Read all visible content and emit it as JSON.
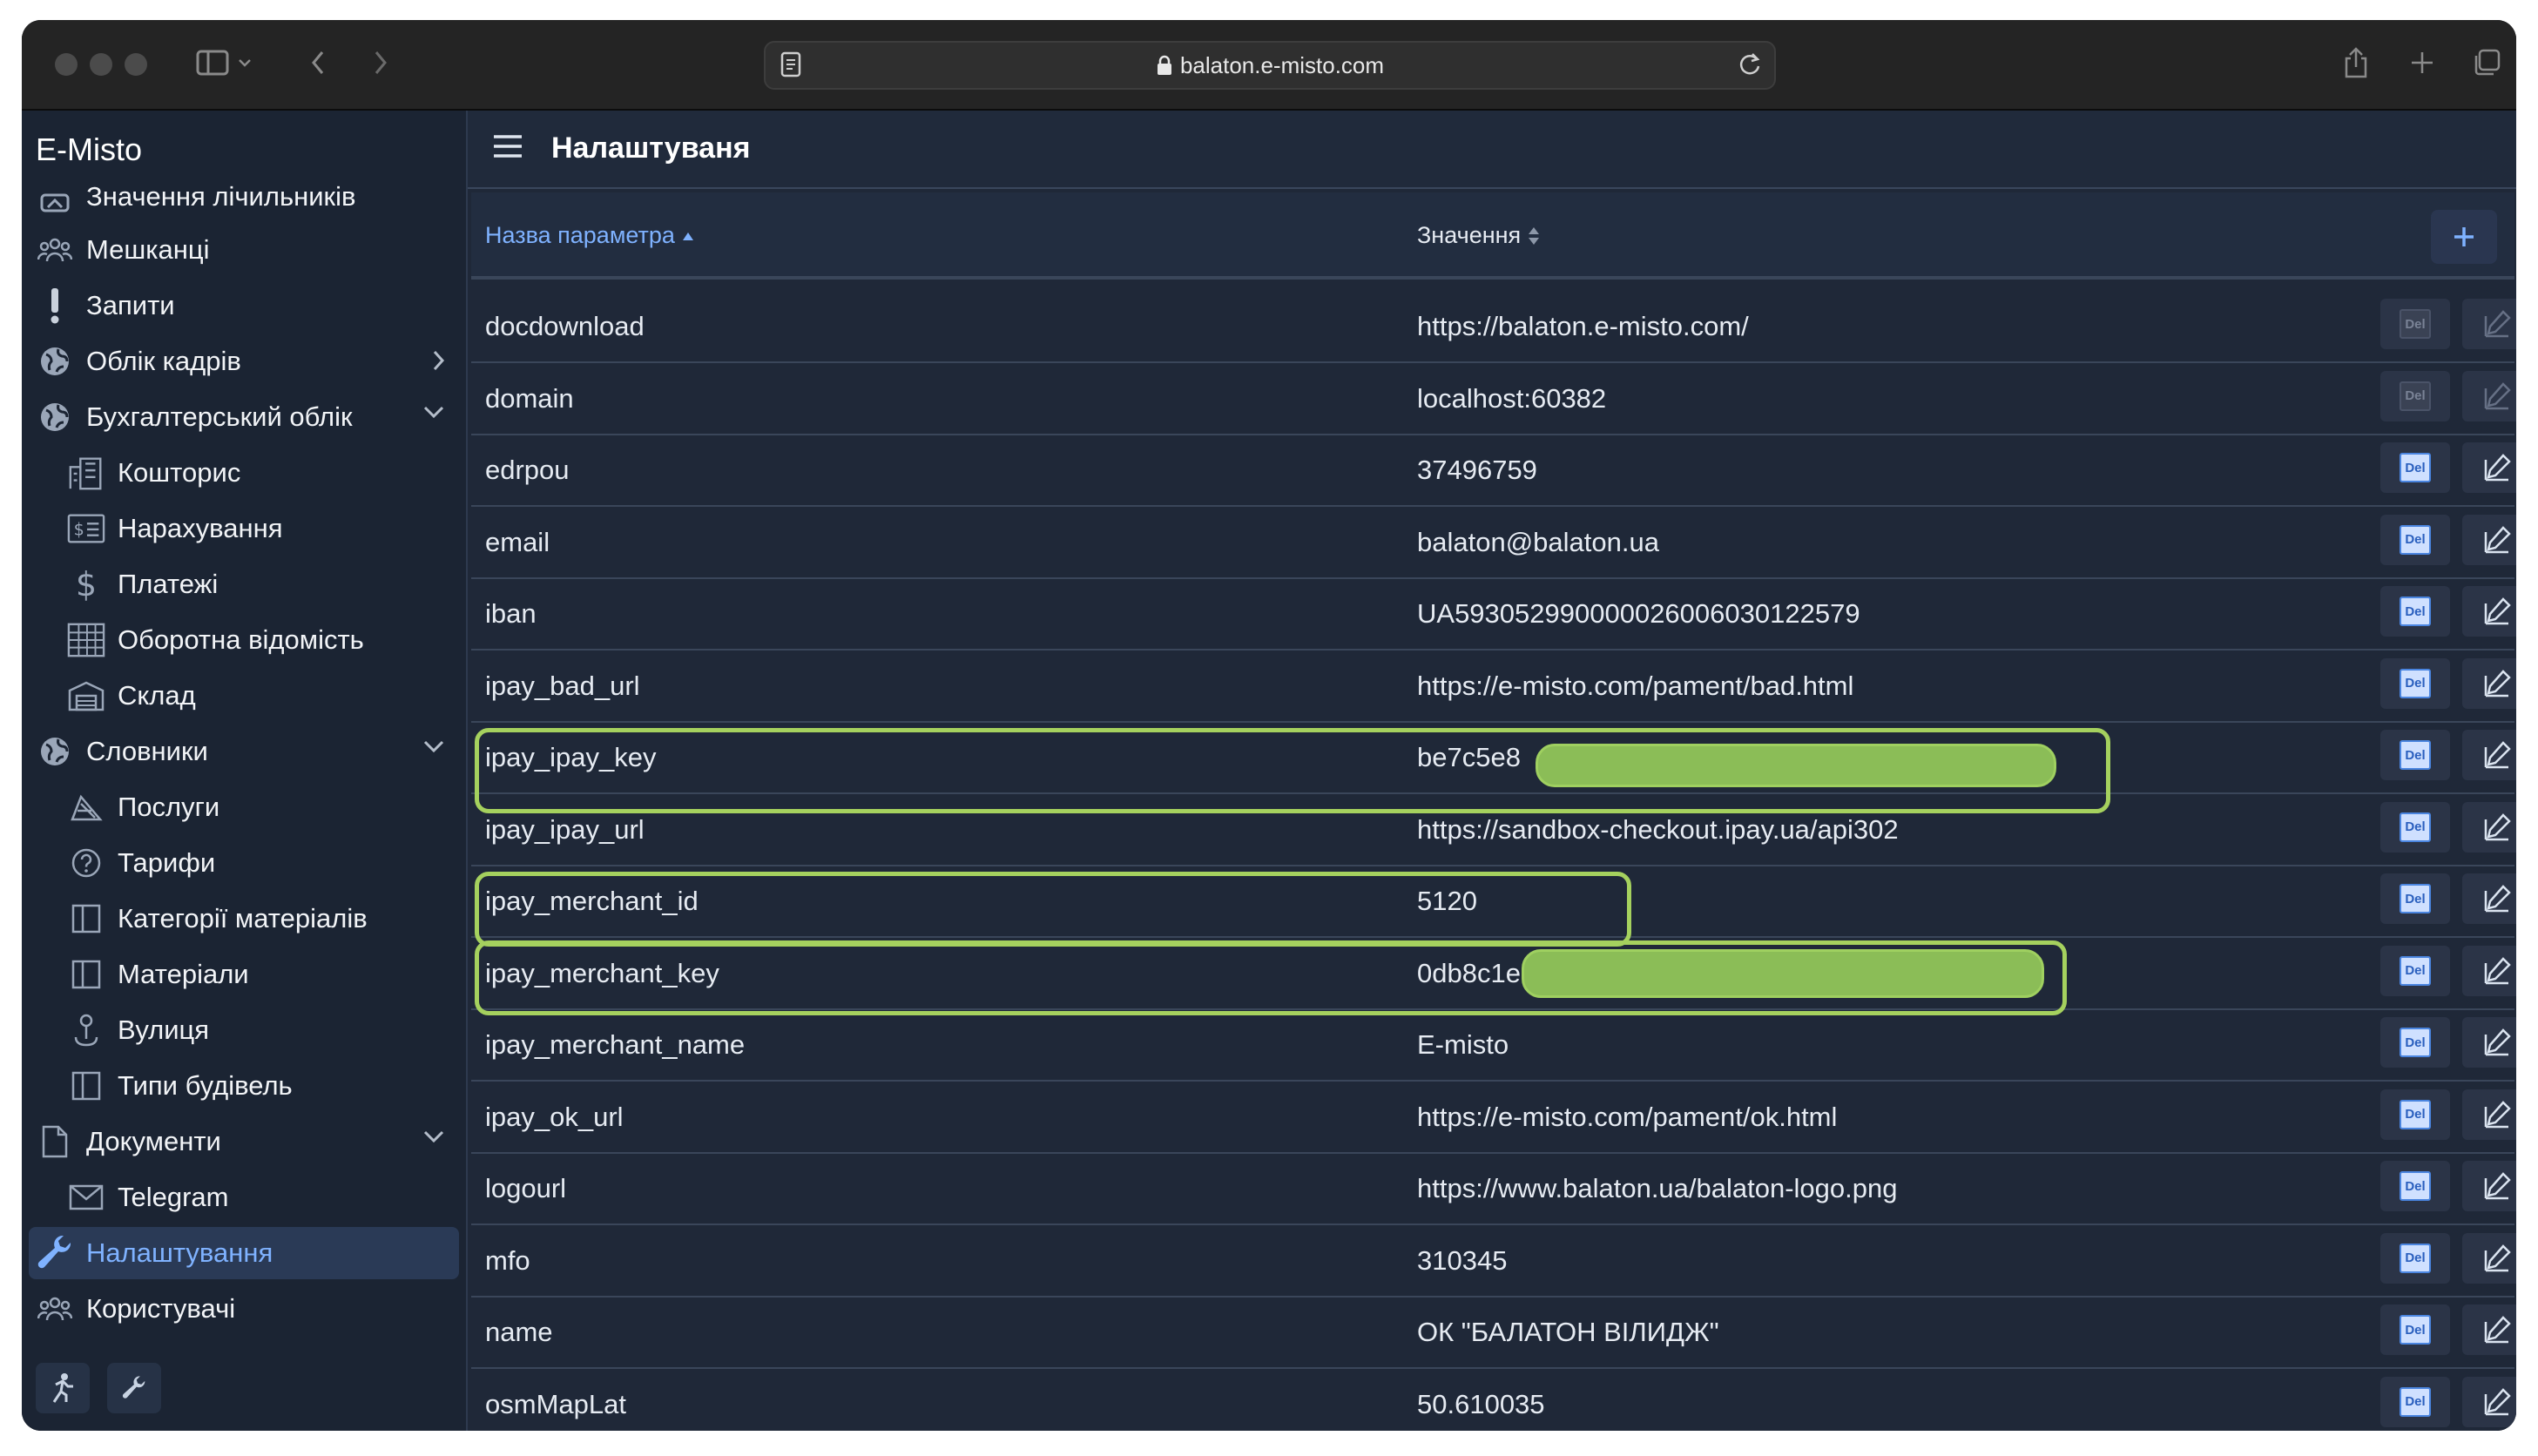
{
  "browser": {
    "url": "balaton.e-misto.com"
  },
  "app": {
    "brand": "E-Misto",
    "page_title": "Налаштуваня"
  },
  "sidebar": {
    "items": [
      {
        "label": "Значення лічильників",
        "icon": "meter-icon"
      },
      {
        "label": "Мешканці",
        "icon": "people-icon"
      },
      {
        "label": "Запити",
        "icon": "exclamation-icon"
      },
      {
        "label": "Облік кадрів",
        "icon": "globe-icon",
        "chevron": "right"
      },
      {
        "label": "Бухгалтерський облік",
        "icon": "globe-icon",
        "chevron": "down"
      },
      {
        "label": "Кошторис",
        "icon": "building-icon",
        "sub": true
      },
      {
        "label": "Нарахування",
        "icon": "invoice-icon",
        "sub": true
      },
      {
        "label": "Платежі",
        "icon": "dollar-icon",
        "sub": true
      },
      {
        "label": "Оборотна відомість",
        "icon": "grid-icon",
        "sub": true
      },
      {
        "label": "Склад",
        "icon": "warehouse-icon",
        "sub": true
      },
      {
        "label": "Словники",
        "icon": "globe-icon",
        "chevron": "down"
      },
      {
        "label": "Послуги",
        "icon": "services-icon",
        "sub": true
      },
      {
        "label": "Тарифи",
        "icon": "question-circle-icon",
        "sub": true
      },
      {
        "label": "Категорії матеріалів",
        "icon": "columns-icon",
        "sub": true
      },
      {
        "label": "Матеріали",
        "icon": "columns-icon",
        "sub": true
      },
      {
        "label": "Вулиця",
        "icon": "pin-icon",
        "sub": true
      },
      {
        "label": "Типи будівель",
        "icon": "columns-icon",
        "sub": true
      },
      {
        "label": "Документи",
        "icon": "document-icon",
        "chevron": "down"
      },
      {
        "label": "Telegram",
        "icon": "mail-icon",
        "sub": true
      },
      {
        "label": "Налаштування",
        "icon": "wrench-icon",
        "active": true
      },
      {
        "label": "Користувачі",
        "icon": "people-icon"
      }
    ]
  },
  "table": {
    "col_name": "Назва параметра",
    "col_value": "Значення",
    "del_label": "Del",
    "rows": [
      {
        "name": "docdownload",
        "value": "https://balaton.e-misto.com/",
        "disabled": true
      },
      {
        "name": "domain",
        "value": "localhost:60382",
        "disabled": true
      },
      {
        "name": "edrpou",
        "value": "37496759"
      },
      {
        "name": "email",
        "value": "balaton@balaton.ua"
      },
      {
        "name": "iban",
        "value": "UA593052990000026006030122579"
      },
      {
        "name": "ipay_bad_url",
        "value": "https://e-misto.com/pament/bad.html"
      },
      {
        "name": "ipay_ipay_key",
        "value": "be7c5e8"
      },
      {
        "name": "ipay_ipay_url",
        "value": "https://sandbox-checkout.ipay.ua/api302"
      },
      {
        "name": "ipay_merchant_id",
        "value": "5120"
      },
      {
        "name": "ipay_merchant_key",
        "value": "0db8c1e"
      },
      {
        "name": "ipay_merchant_name",
        "value": "E-misto"
      },
      {
        "name": "ipay_ok_url",
        "value": "https://e-misto.com/pament/ok.html"
      },
      {
        "name": "logourl",
        "value": "https://www.balaton.ua/balaton-logo.png"
      },
      {
        "name": "mfo",
        "value": "310345"
      },
      {
        "name": "name",
        "value": "ОК \"БАЛАТОН ВІЛИДЖ\""
      },
      {
        "name": "osmMapLat",
        "value": "50.610035"
      }
    ]
  },
  "colors": {
    "highlight": "#a5d15e",
    "redaction": "#8bbd57",
    "link": "#7fb2ff",
    "background": "#1f2838"
  }
}
